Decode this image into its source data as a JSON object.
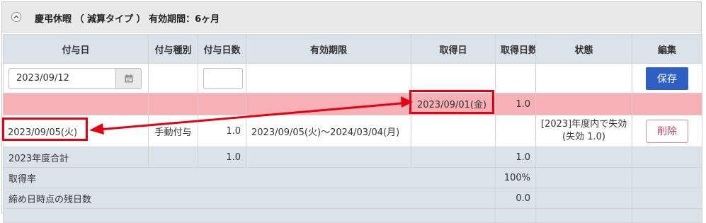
{
  "panel": {
    "title": "慶弔休暇 （ 減算タイプ ） 有効期間：6ヶ月"
  },
  "table": {
    "headers": [
      "付与日",
      "付与種別",
      "付与日数",
      "有効期限",
      "取得日",
      "取得日数",
      "状態",
      "編集"
    ],
    "form": {
      "date_value": "2023/09/12",
      "days_value": "",
      "save_label": "保存"
    },
    "taken_row": {
      "date": "2023/09/01(金)",
      "days": "1.0"
    },
    "grant_row": {
      "date": "2023/09/05(火)",
      "type": "手動付与",
      "days": "1.0",
      "validity": "2023/09/05(火)～2024/03/04(月)",
      "status_line1": "[2023]年度内で失効",
      "status_line2": "(失効 1.0)",
      "delete_label": "削除"
    },
    "summary": {
      "label": "2023年度合計",
      "granted": "1.0",
      "taken": "1.0"
    },
    "rate": {
      "label": "取得率",
      "value": "100%"
    },
    "remaining": {
      "label": "締め日時点の残日数",
      "value": "0.0"
    }
  },
  "colors": {
    "highlight": "#e60012",
    "taken_row_bg": "#f7b0b6",
    "save_button": "#2d5fc4",
    "delete_button_text": "#c0455a",
    "header_bg": "#dce2ea"
  },
  "icons": [
    "chevron-up-icon",
    "calendar-icon"
  ]
}
